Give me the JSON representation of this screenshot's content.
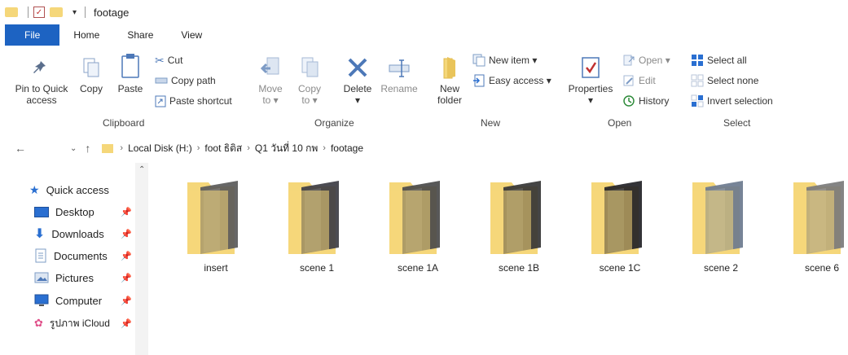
{
  "window": {
    "title": "footage"
  },
  "ribbon_tabs": [
    "File",
    "Home",
    "Share",
    "View"
  ],
  "clipboard": {
    "group_label": "Clipboard",
    "pin_label_1": "Pin to Quick",
    "pin_label_2": "access",
    "copy_label": "Copy",
    "paste_label": "Paste",
    "cut_label": "Cut",
    "copy_path_label": "Copy path",
    "paste_shortcut_label": "Paste shortcut"
  },
  "organize": {
    "group_label": "Organize",
    "move_to_1": "Move",
    "move_to_2": "to",
    "copy_to_1": "Copy",
    "copy_to_2": "to",
    "delete_label": "Delete",
    "rename_label": "Rename"
  },
  "new": {
    "group_label": "New",
    "new_folder_1": "New",
    "new_folder_2": "folder",
    "new_item_label": "New item",
    "easy_access_label": "Easy access"
  },
  "open": {
    "group_label": "Open",
    "properties_label": "Properties",
    "open_label": "Open",
    "edit_label": "Edit",
    "history_label": "History"
  },
  "select": {
    "group_label": "Select",
    "select_all_label": "Select all",
    "select_none_label": "Select none",
    "invert_label": "Invert selection"
  },
  "breadcrumb": [
    "Local Disk (H:)",
    "foot ธิติส",
    "Q1 วันที่ 10 กพ",
    "footage"
  ],
  "nav_pane": {
    "quick_access": "Quick access",
    "items": [
      {
        "label": "Desktop",
        "icon": "desktop-icon"
      },
      {
        "label": "Downloads",
        "icon": "downloads-icon"
      },
      {
        "label": "Documents",
        "icon": "documents-icon"
      },
      {
        "label": "Pictures",
        "icon": "pictures-icon"
      },
      {
        "label": "Computer",
        "icon": "computer-icon"
      },
      {
        "label": "รูปภาพ iCloud",
        "icon": "icloud-photos-icon"
      }
    ]
  },
  "folders": [
    {
      "name": "insert",
      "thumb": "#5a5a5a"
    },
    {
      "name": "scene 1",
      "thumb": "#3d3d44"
    },
    {
      "name": "scene 1A",
      "thumb": "#4a4a4a"
    },
    {
      "name": "scene 1B",
      "thumb": "#353535"
    },
    {
      "name": "scene 1C",
      "thumb": "#222226"
    },
    {
      "name": "scene 2",
      "thumb": "#6b7a8e"
    },
    {
      "name": "scene 6",
      "thumb": "#7a7a7a"
    }
  ],
  "colors": {
    "file_tab": "#1d63c2",
    "folder": "#f5d77a",
    "folder_dark": "#e9c45a",
    "accent": "#2a6fd1"
  }
}
